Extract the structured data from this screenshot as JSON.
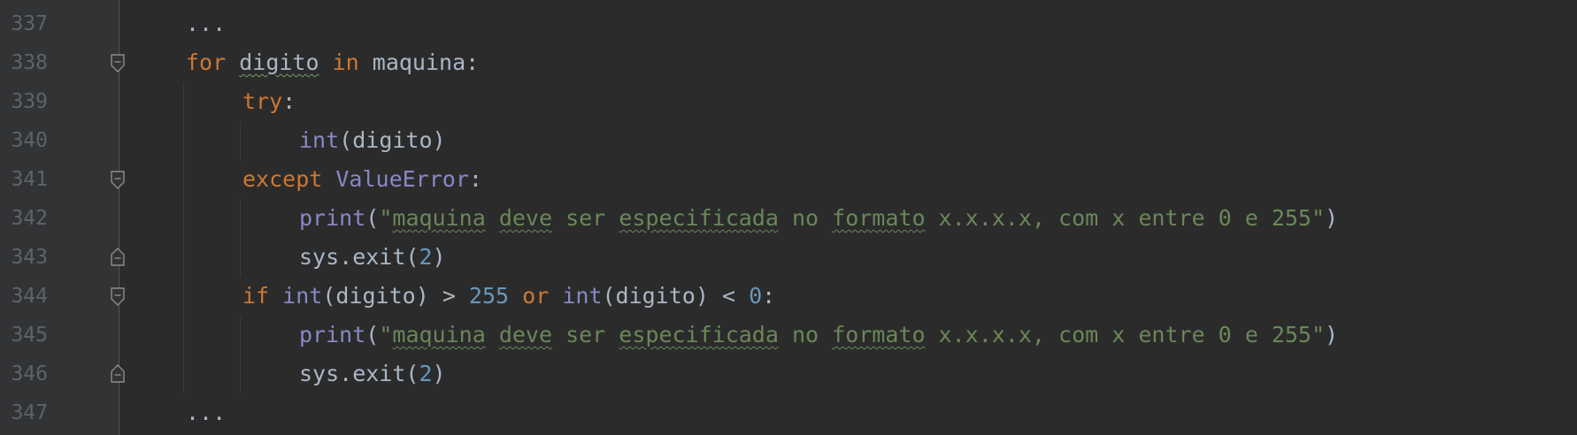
{
  "line_numbers": [
    "337",
    "338",
    "339",
    "340",
    "341",
    "342",
    "343",
    "344",
    "345",
    "346",
    "347"
  ],
  "tokens": {
    "ellipsis": "...",
    "for": "for",
    "digito": "digito",
    "in": "in",
    "maquina": "maquina",
    "colon": ":",
    "try": "try",
    "int": "int",
    "lparen": "(",
    "rparen": ")",
    "except": "except",
    "ValueError": "ValueError",
    "print": "print",
    "str_quote_open": "\"",
    "str_maquina": "maquina",
    "str_deve": "deve",
    "str_ser": " ser ",
    "str_especificada": "especificada",
    "str_no": " no ",
    "str_formato": "formato",
    "str_tail": " x.x.x.x, com x entre 0 e 255\"",
    "sys_exit": "sys.exit",
    "two": "2",
    "if": "if",
    "gt": " > ",
    "n255": "255",
    "or": "or",
    "lt": " < ",
    "zero": "0"
  },
  "colors": {
    "background": "#2b2b2b",
    "gutter": "#313335",
    "keyword": "#cc7832",
    "builtin": "#8888c6",
    "string": "#6a8759",
    "number": "#6897bb",
    "text": "#a9b7c6",
    "line_number": "#606366"
  }
}
